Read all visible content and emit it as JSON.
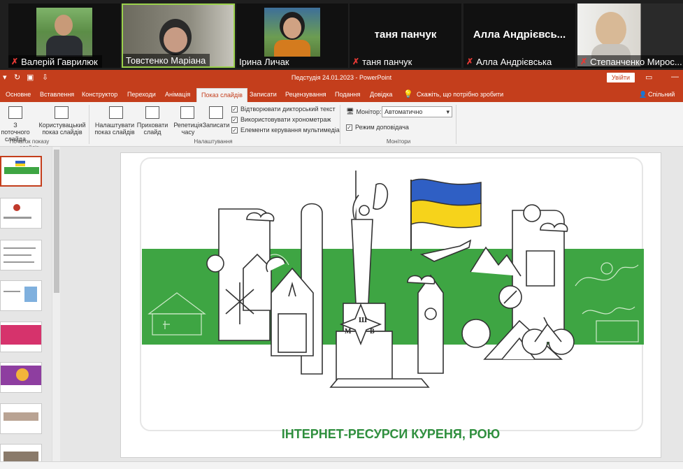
{
  "participants": [
    {
      "name": "Валерій Гаврилюк",
      "muted": true,
      "video": true
    },
    {
      "name": "Товстенко Маріана",
      "muted": false,
      "video": true,
      "active": true
    },
    {
      "name": "Ірина Личак",
      "muted": false,
      "video": true
    },
    {
      "name": "таня панчук",
      "muted": true,
      "video": false
    },
    {
      "name": "Алла Андрієвська",
      "muted": true,
      "video": false,
      "display_name": "Алла Андрієвсь..."
    },
    {
      "name": "Степанченко Мирос...",
      "muted": true,
      "video": true
    }
  ],
  "window": {
    "title": "Педстудія 24.01.2023 - PowerPoint",
    "signin_label": "Увійти",
    "share_label": "Спільний до"
  },
  "tabs": [
    "Основне",
    "Вставлення",
    "Конструктор",
    "Переходи",
    "Анімація",
    "Показ слайдів",
    "Записати",
    "Рецензування",
    "Подання",
    "Довідка"
  ],
  "active_tab": "Показ слайдів",
  "tell_me": "Скажіть, що потрібно зробити",
  "ribbon": {
    "from_current": "З поточного слайда",
    "custom_show": "Користувацький показ слайдів",
    "setup_show": "Налаштувати показ слайдів",
    "hide_slide": "Приховати слайд",
    "rehearse": "Репетиція часу",
    "record": "Записати",
    "play_narrations": "Відтворювати дикторський текст",
    "use_timings": "Використовувати хронометраж",
    "media_controls": "Елементи керування мультимедіа",
    "monitor_label": "Монітор:",
    "monitor_value": "Автоматично",
    "presenter_view": "Режим доповідача",
    "group_start": "Початок показу слайдів",
    "group_setup": "Налаштування",
    "group_monitors": "Монітори"
  },
  "slide": {
    "title": "ІНТЕРНЕТ-РЕСУРСИ КУРЕНЯ, РОЮ",
    "emblem_letters": [
      "Ш",
      "М",
      "В"
    ]
  },
  "colors": {
    "accent": "#c43e1c",
    "green_band": "#3ea543",
    "flag_blue": "#2f5fc4",
    "flag_yellow": "#f6d31b",
    "title_green": "#2f8f3e"
  }
}
